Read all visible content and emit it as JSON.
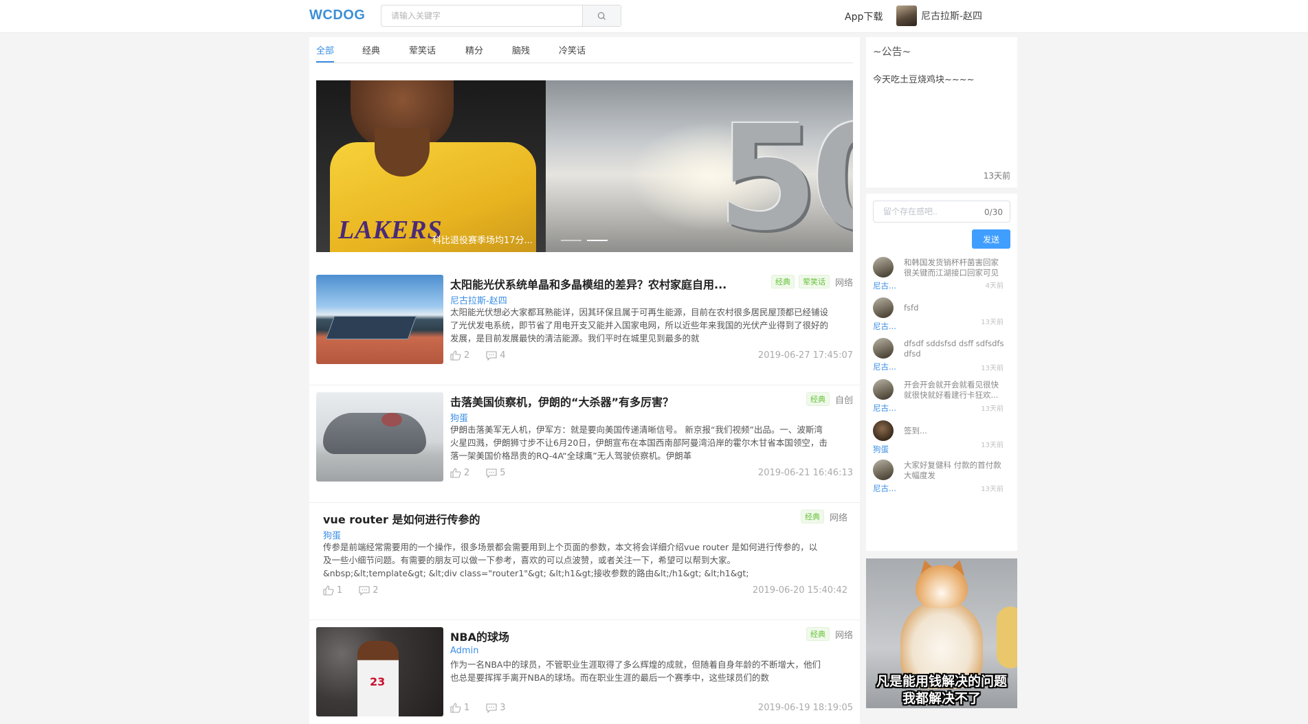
{
  "header": {
    "logo": "WCDOG",
    "search_placeholder": "请输入关键字",
    "app_download": "App下载",
    "username": "尼古拉斯-赵四"
  },
  "tabs": [
    {
      "label": "全部",
      "active": true
    },
    {
      "label": "经典",
      "active": false
    },
    {
      "label": "荤笑话",
      "active": false
    },
    {
      "label": "精分",
      "active": false
    },
    {
      "label": "脑残",
      "active": false
    },
    {
      "label": "冷笑话",
      "active": false
    }
  ],
  "banner": {
    "jersey_text": "LAKERS",
    "big_number": "50",
    "caption": "科比退役赛季场均17分...",
    "slides": 2,
    "active_slide": 2
  },
  "articles": [
    {
      "title": "太阳能光伏系统单晶和多晶模组的差异？农村家庭自用...",
      "author": "尼古拉斯-赵四",
      "summary": "太阳能光伏想必大家都耳熟能详，因其环保且属于可再生能源，目前在农村很多居民屋顶都已经铺设了光伏发电系统，即节省了用电开支又能并入国家电网，所以近些年来我国的光伏产业得到了很好的发展，是目前发展最快的清洁能源。我们平时在城里见到最多的就",
      "tags": [
        "经典",
        "荤笑话"
      ],
      "source": "网络",
      "likes": "2",
      "comments": "4",
      "date": "2019-06-27 17:45:07"
    },
    {
      "title": "击落美国侦察机，伊朗的“大杀器”有多厉害？",
      "author": "狗蛋",
      "summary": "伊朗击落美军无人机，伊军方：就是要向美国传递清晰信号。 新京报“我们视频”出品。一、波斯湾火星四溅，伊朗狮寸步不让6月20日，伊朗宣布在本国西南部阿曼湾沿岸的霍尔木甘省本国领空，击落一架美国价格昂贵的RQ-4A“全球鹰”无人驾驶侦察机。伊朗革",
      "tags": [
        "经典"
      ],
      "source": "自创",
      "likes": "2",
      "comments": "5",
      "date": "2019-06-21 16:46:13"
    },
    {
      "title": "vue router 是如何进行传参的",
      "author": "狗蛋",
      "summary": "传参是前端经常需要用的一个操作，很多场景都会需要用到上个页面的参数，本文将会详细介绍vue router 是如何进行传参的，以及一些小细节问题。有需要的朋友可以做一下参考，喜欢的可以点波赞，或者关注一下，希望可以帮到大家。&nbsp;&lt;template&gt; &lt;div class=\"router1\"&gt; &lt;h1&gt;接收参数的路由&lt;/h1&gt; &lt;h1&gt;",
      "tags": [
        "经典"
      ],
      "source": "网络",
      "likes": "1",
      "comments": "2",
      "date": "2019-06-20 15:40:42"
    },
    {
      "title": "NBA的球场",
      "author": "Admin",
      "summary": "作为一名NBA中的球员，不管职业生涯取得了多么辉煌的成就，但随着自身年龄的不断增大，他们也总是要挥挥手离开NBA的球场。而在职业生涯的最后一个赛季中，这些球员们的数",
      "tags": [
        "经典"
      ],
      "source": "网络",
      "likes": "1",
      "comments": "3",
      "date": "2019-06-19 18:19:05"
    }
  ],
  "notice": {
    "title": "~公告~",
    "text": "今天吃土豆烧鸡块~~~~",
    "time": "13天前"
  },
  "chat": {
    "placeholder": "留个存在感吧..",
    "counter": "0/30",
    "send_label": "发送",
    "messages": [
      {
        "name": "尼古...",
        "text": "和韩国发货销杯杆菌害回家很关键而江湖接口回家可见",
        "time": "4天前"
      },
      {
        "name": "尼古...",
        "text": "fsfd",
        "time": "13天前"
      },
      {
        "name": "尼古...",
        "text": "dfsdf sddsfsd dsff sdfsdfs dfsd",
        "time": "13天前"
      },
      {
        "name": "尼古...",
        "text": "开会开会就开会就看见很快就很快就好看建行卡狂欢...",
        "time": "13天前"
      },
      {
        "name": "狗蛋",
        "text": "签到...",
        "time": "13天前"
      },
      {
        "name": "尼古...",
        "text": "大家好复健科 付款的首付款大幅度发",
        "time": "13天前"
      }
    ]
  },
  "ad": {
    "caption_line1": "凡是能用钱解决的问题",
    "caption_line2": "我都解决不了"
  }
}
